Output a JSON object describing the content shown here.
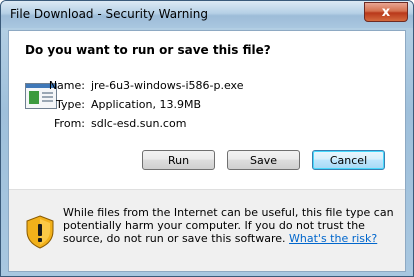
{
  "window": {
    "title": "File Download - Security Warning",
    "close_glyph": "x"
  },
  "prompt": {
    "heading": "Do you want to run or save this file?"
  },
  "file": {
    "icon": "file-icon",
    "fields": [
      {
        "label": "Name:",
        "value": "jre-6u3-windows-i586-p.exe"
      },
      {
        "label": "Type:",
        "value": "Application, 13.9MB"
      },
      {
        "label": "From:",
        "value": "sdlc-esd.sun.com"
      }
    ]
  },
  "buttons": {
    "run": "Run",
    "save": "Save",
    "cancel": "Cancel"
  },
  "warning": {
    "icon": "shield-warning-icon",
    "text": "While files from the Internet can be useful, this file type can potentially harm your computer. If you do not trust the source, do not run or save this software.",
    "link": "What's the risk?"
  },
  "colors": {
    "accent_link": "#0066cc",
    "close_button": "#c8502f",
    "shield": "#f2b11a"
  }
}
